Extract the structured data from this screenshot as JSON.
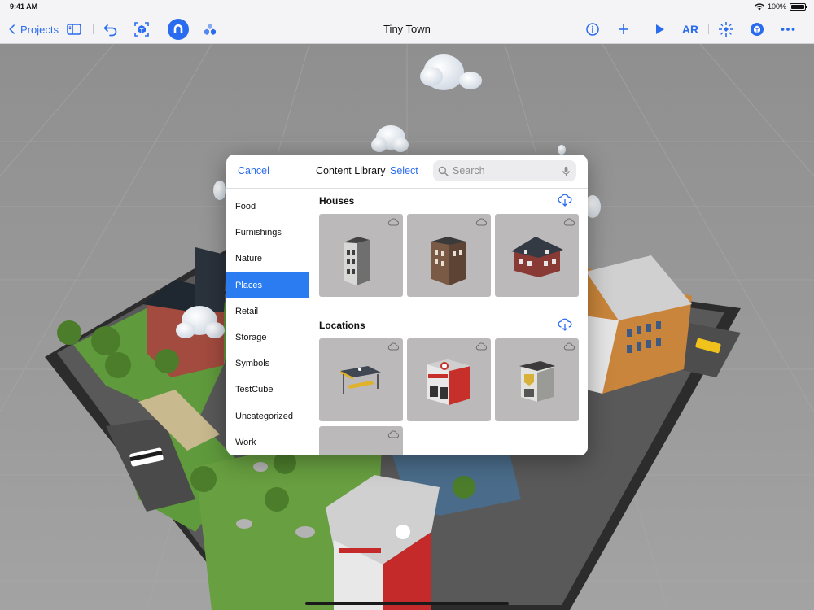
{
  "status": {
    "time": "9:41 AM",
    "battery": "100%"
  },
  "toolbar": {
    "back_label": "Projects",
    "title": "Tiny Town",
    "ar_label": "AR",
    "icons": [
      "chevron-left-icon",
      "sidebar-icon",
      "undo-icon",
      "scan-cube-icon",
      "magnet-icon",
      "behaviors-icon",
      "info-icon",
      "plus-icon",
      "play-icon",
      "ar-button",
      "snap-icon",
      "settings-cube-icon",
      "more-icon"
    ]
  },
  "popover": {
    "cancel_label": "Cancel",
    "title": "Content Library",
    "select_label": "Select",
    "search_placeholder": "Search",
    "categories": [
      {
        "label": "Food"
      },
      {
        "label": "Furnishings"
      },
      {
        "label": "Nature"
      },
      {
        "label": "Places",
        "selected": true
      },
      {
        "label": "Retail"
      },
      {
        "label": "Storage"
      },
      {
        "label": "Symbols"
      },
      {
        "label": "TestCube"
      },
      {
        "label": "Uncategorized"
      },
      {
        "label": "Work"
      }
    ],
    "sections": [
      {
        "title": "Houses",
        "items": [
          "narrow-townhouse",
          "brick-townhouse",
          "brick-mansion"
        ]
      },
      {
        "title": "Locations",
        "items": [
          "bus-stop",
          "fire-station",
          "police-station",
          "unknown-location"
        ]
      }
    ]
  },
  "colors": {
    "accent": "#2a6cf0",
    "selected_row": "#2a7cf0",
    "tile_bg": "#bcb9bb",
    "scene_bg": "#9a9a9a"
  }
}
